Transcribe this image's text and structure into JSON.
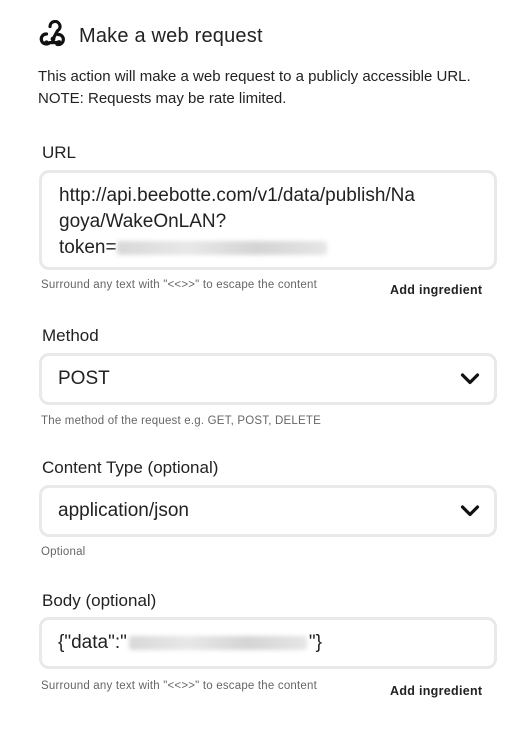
{
  "header": {
    "icon": "webhooks-icon",
    "title": "Make a web request"
  },
  "description": {
    "line1": "This action will make a web request to a publicly accessible URL.",
    "line2": "NOTE: Requests may be rate limited."
  },
  "url": {
    "label": "URL",
    "value_line1": "http://api.beebotte.com/v1/data/publish/Na",
    "value_line2": "goya/WakeOnLAN?",
    "value_line3_prefix": "token=",
    "helper": "Surround any text with \"<<>>\" to escape the content",
    "add_ingredient": "Add ingredient"
  },
  "method": {
    "label": "Method",
    "value": "POST",
    "helper": "The method of the request e.g. GET, POST, DELETE"
  },
  "content_type": {
    "label": "Content Type (optional)",
    "value": "application/json",
    "helper": "Optional"
  },
  "body": {
    "label": "Body (optional)",
    "value_prefix": "{\"data\":\"",
    "value_suffix": "\"}",
    "helper": "Surround any text with \"<<>>\" to escape the content",
    "add_ingredient": "Add ingredient"
  }
}
